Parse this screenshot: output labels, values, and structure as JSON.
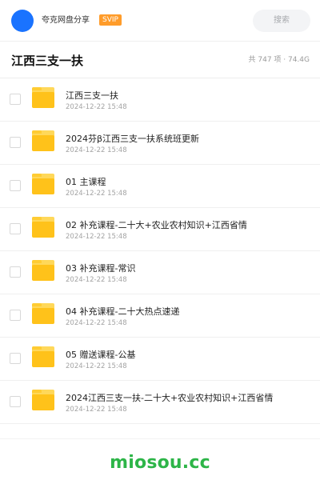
{
  "header": {
    "app_name": "夸克网盘分享",
    "badge": "SVIP",
    "search_placeholder": "搜索",
    "avatar_color": "#1a73ff",
    "badge_color": "#ff9c2a"
  },
  "folder": {
    "title": "江西三支一扶",
    "stats": "共 747 项 · 74.4G"
  },
  "files": [
    {
      "name": "江西三支一扶",
      "date": "2024-12-22 15:48",
      "icon": "folder-icon"
    },
    {
      "name": "2024芬β江西三支一扶系统班更新",
      "date": "2024-12-22 15:48",
      "icon": "folder-icon"
    },
    {
      "name": "01 主课程",
      "date": "2024-12-22 15:48",
      "icon": "folder-icon"
    },
    {
      "name": "02 补充课程-二十大+农业农村知识+江西省情",
      "date": "2024-12-22 15:48",
      "icon": "folder-icon"
    },
    {
      "name": "03 补充课程-常识",
      "date": "2024-12-22 15:48",
      "icon": "folder-icon"
    },
    {
      "name": "04 补充课程-二十大热点速递",
      "date": "2024-12-22 15:48",
      "icon": "folder-icon"
    },
    {
      "name": "05 赠送课程-公基",
      "date": "2024-12-22 15:48",
      "icon": "folder-icon"
    },
    {
      "name": "2024江西三支一扶-二十大+农业农村知识+江西省情",
      "date": "2024-12-22 15:48",
      "icon": "folder-icon"
    }
  ],
  "footer": {
    "brand": "miosou.cc",
    "brand_color": "#2db548"
  }
}
